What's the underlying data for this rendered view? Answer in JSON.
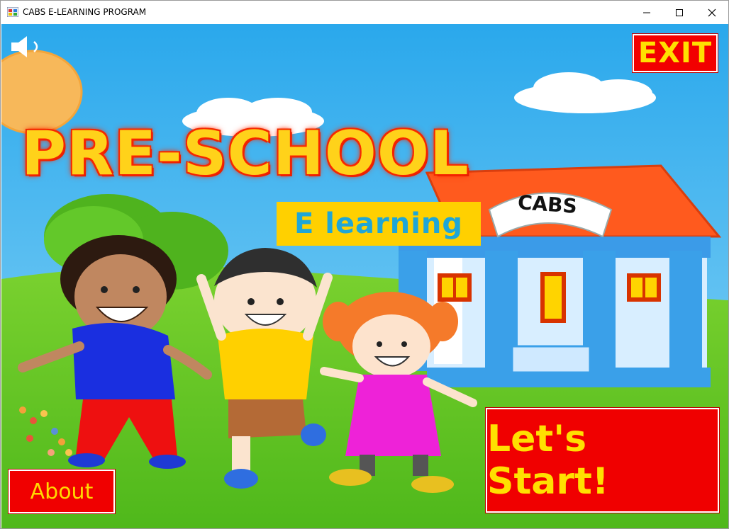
{
  "window": {
    "title": "CABS E-LEARNING PROGRAM",
    "controls": [
      "minimize-icon",
      "maximize-icon",
      "close-icon"
    ]
  },
  "scene": {
    "headline": "PRE-SCHOOL",
    "subtitle": "E learning",
    "school_sign": "CABS"
  },
  "buttons": {
    "exit": "EXIT",
    "about": "About",
    "start": "Let's Start!",
    "sound_icon": "speaker-icon"
  },
  "colors": {
    "sky": "#3cb4ee",
    "grass": "#5ec520",
    "button_red": "#f00000",
    "button_text_yellow": "#ffe000",
    "headline_yellow": "#ffd21a",
    "subtitle_blue": "#1fa6d6",
    "roof_orange": "#ff5a1e"
  }
}
